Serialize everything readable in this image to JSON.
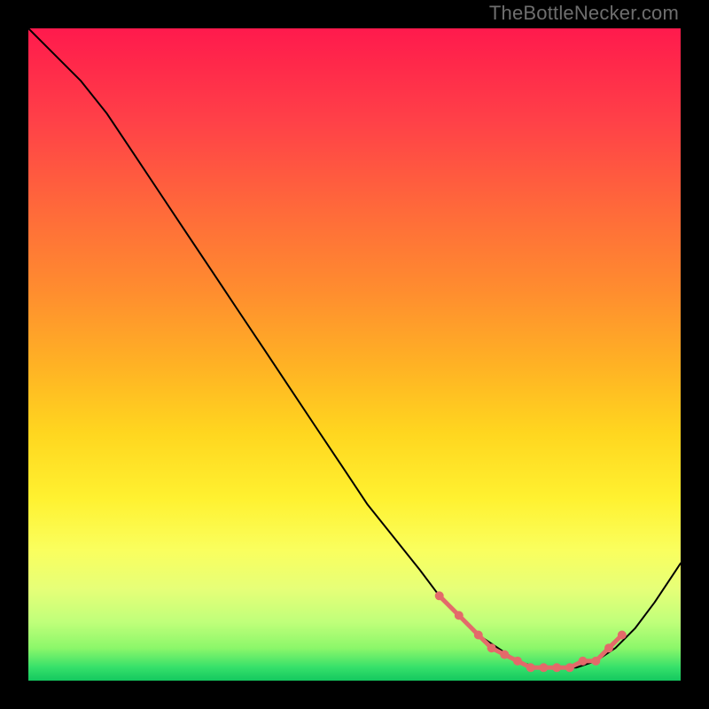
{
  "watermark": "TheBottleNecker.com",
  "colors": {
    "background": "#000000",
    "gradient_top": "#ff1a4d",
    "gradient_mid": "#ffd61f",
    "gradient_bottom": "#14c85f",
    "curve": "#000000",
    "markers": "#e36a6a"
  },
  "chart_data": {
    "type": "line",
    "title": "",
    "xlabel": "",
    "ylabel": "",
    "xlim": [
      0,
      100
    ],
    "ylim": [
      0,
      100
    ],
    "series": [
      {
        "name": "bottleneck-curve",
        "x": [
          0,
          4,
          8,
          12,
          16,
          20,
          24,
          28,
          32,
          36,
          40,
          44,
          48,
          52,
          56,
          60,
          63,
          66,
          69,
          72,
          75,
          78,
          81,
          84,
          87,
          90,
          93,
          96,
          100
        ],
        "y": [
          100,
          96,
          92,
          87,
          81,
          75,
          69,
          63,
          57,
          51,
          45,
          39,
          33,
          27,
          22,
          17,
          13,
          10,
          7,
          5,
          3,
          2,
          2,
          2,
          3,
          5,
          8,
          12,
          18
        ]
      }
    ],
    "markers": {
      "name": "optimal-region",
      "x": [
        63,
        66,
        69,
        71,
        73,
        75,
        77,
        79,
        81,
        83,
        85,
        87,
        89,
        91
      ],
      "y": [
        13,
        10,
        7,
        5,
        4,
        3,
        2,
        2,
        2,
        2,
        3,
        3,
        5,
        7
      ]
    }
  }
}
